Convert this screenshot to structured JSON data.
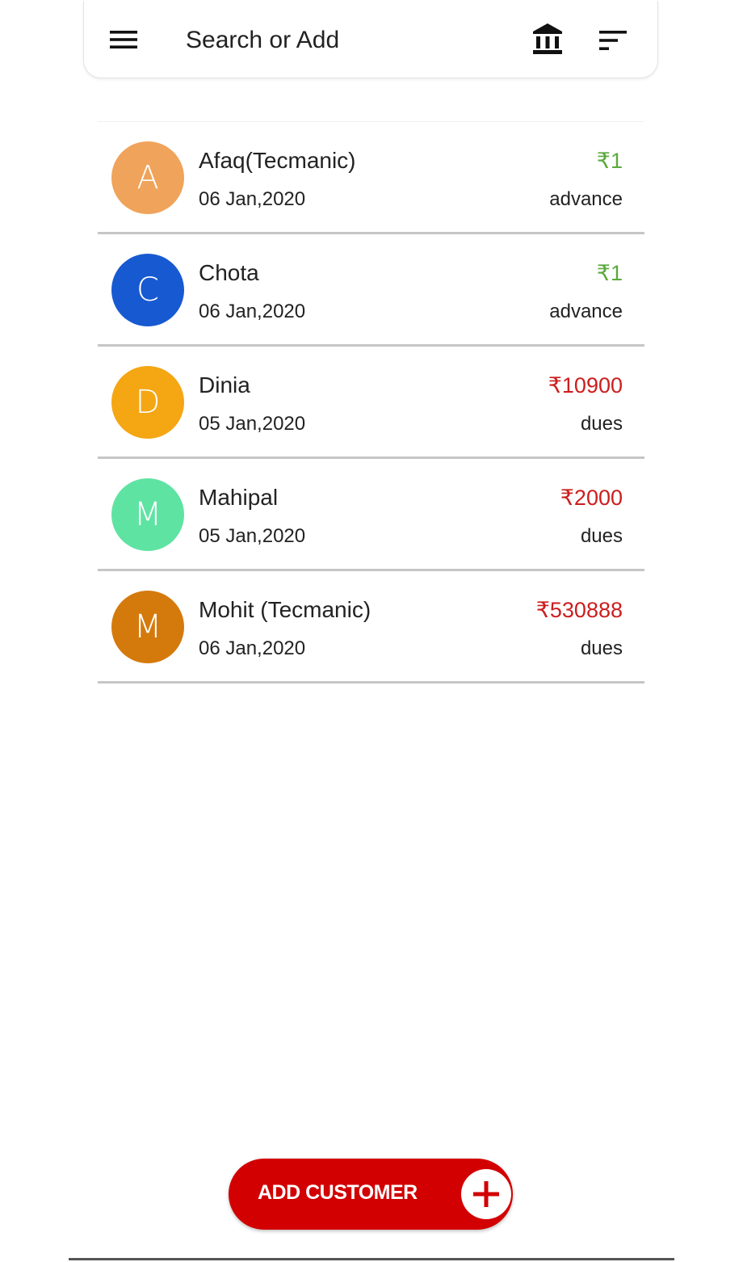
{
  "search": {
    "placeholder": "Search or Add"
  },
  "icons": {
    "menu": "menu-icon",
    "bank": "bank-icon",
    "sort": "sort-icon",
    "add": "plus-icon"
  },
  "customers": [
    {
      "initial": "A",
      "name": "Afaq(Tecmanic)",
      "date": "06 Jan,2020",
      "amount": "₹1",
      "status": "advance",
      "avatar_color": "#f0a35a",
      "amount_color": "#5aaa3c"
    },
    {
      "initial": "C",
      "name": "Chota",
      "date": "06 Jan,2020",
      "amount": "₹1",
      "status": "advance",
      "avatar_color": "#1759d1",
      "amount_color": "#5aaa3c"
    },
    {
      "initial": "D",
      "name": "Dinia",
      "date": "05 Jan,2020",
      "amount": "₹10900",
      "status": "dues",
      "avatar_color": "#f4a613",
      "amount_color": "#cc1e1e"
    },
    {
      "initial": "M",
      "name": "Mahipal",
      "date": "05 Jan,2020",
      "amount": "₹2000",
      "status": "dues",
      "avatar_color": "#5fe3a3",
      "amount_color": "#cc1e1e"
    },
    {
      "initial": "M",
      "name": "Mohit (Tecmanic)",
      "date": "06 Jan,2020",
      "amount": "₹530888",
      "status": "dues",
      "avatar_color": "#d47a0c",
      "amount_color": "#cc1e1e"
    }
  ],
  "add_customer": {
    "label": "ADD CUSTOMER",
    "color": "#d20000"
  }
}
